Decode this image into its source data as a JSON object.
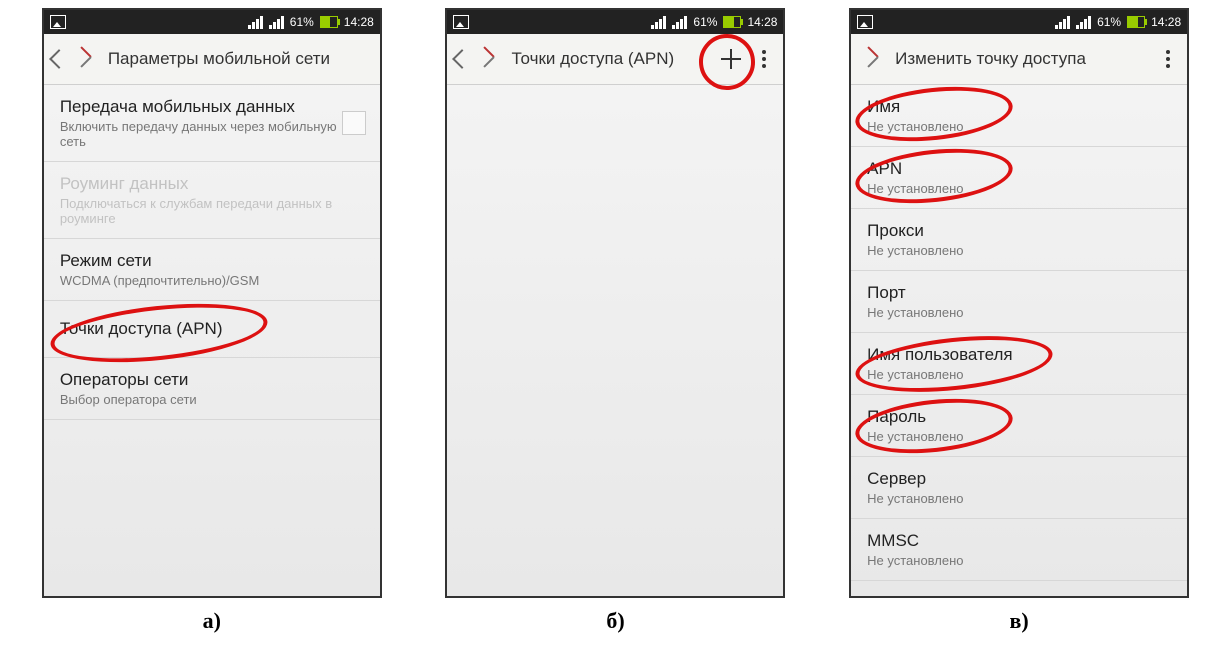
{
  "statusbar": {
    "battery": "61%",
    "time": "14:28"
  },
  "captions": {
    "a": "a)",
    "b": "б)",
    "c": "в)"
  },
  "screenA": {
    "title": "Параметры мобильной сети",
    "items": [
      {
        "title": "Передача мобильных данных",
        "sub": "Включить передачу данных через мобильную сеть",
        "checkbox": true
      },
      {
        "title": "Роуминг данных",
        "sub": "Подключаться к службам передачи данных в роуминге",
        "disabled": true
      },
      {
        "title": "Режим сети",
        "sub": "WCDMA (предпочтительно)/GSM"
      },
      {
        "title": "Точки доступа (APN)"
      },
      {
        "title": "Операторы сети",
        "sub": "Выбор оператора сети"
      }
    ]
  },
  "screenB": {
    "title": "Точки доступа (APN)"
  },
  "screenC": {
    "title": "Изменить точку доступа",
    "items": [
      {
        "title": "Имя",
        "sub": "Не установлено"
      },
      {
        "title": "APN",
        "sub": "Не установлено"
      },
      {
        "title": "Прокси",
        "sub": "Не установлено"
      },
      {
        "title": "Порт",
        "sub": "Не установлено"
      },
      {
        "title": "Имя пользователя",
        "sub": "Не установлено"
      },
      {
        "title": "Пароль",
        "sub": "Не установлено"
      },
      {
        "title": "Сервер",
        "sub": "Не установлено"
      },
      {
        "title": "MMSC",
        "sub": "Не установлено"
      }
    ]
  }
}
